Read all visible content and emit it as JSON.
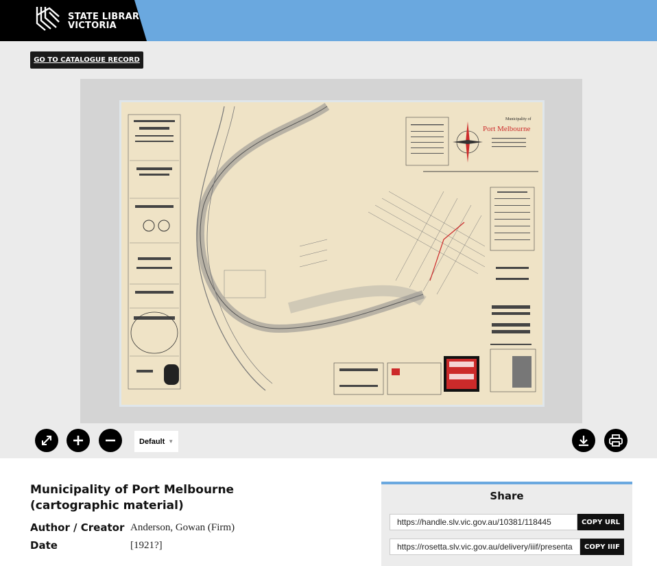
{
  "header": {
    "logo_line1": "STATE LIBRARY",
    "logo_line2": "VICTORIA",
    "logo_icon": "slv-logo-icon"
  },
  "catalogue_button": "GO TO CATALOGUE RECORD",
  "viewer": {
    "image_subject": "map-image",
    "map_title_line1": "Municipality of",
    "map_title_line2": "Port Melbourne"
  },
  "toolbar": {
    "fullscreen_icon": "fullscreen-icon",
    "zoom_in_icon": "zoom-in-icon",
    "zoom_out_icon": "zoom-out-icon",
    "view_mode": "Default",
    "download_icon": "download-icon",
    "print_icon": "print-icon"
  },
  "record": {
    "title": "Municipality of Port Melbourne (cartographic material)",
    "author_label": "Author / Creator",
    "author_value": "Anderson, Gowan (Firm)",
    "date_label": "Date",
    "date_value": "[1921?]"
  },
  "share": {
    "title": "Share",
    "url_value": "https://handle.slv.vic.gov.au/10381/118445",
    "url_button": "COPY URL",
    "iiif_value": "https://rosetta.slv.vic.gov.au/delivery/iiif/presenta",
    "iiif_button": "COPY IIIF"
  },
  "colors": {
    "header_blue": "#6aa8df",
    "map_paper": "#efe3c6",
    "viewer_bg": "#d4d4d4"
  }
}
